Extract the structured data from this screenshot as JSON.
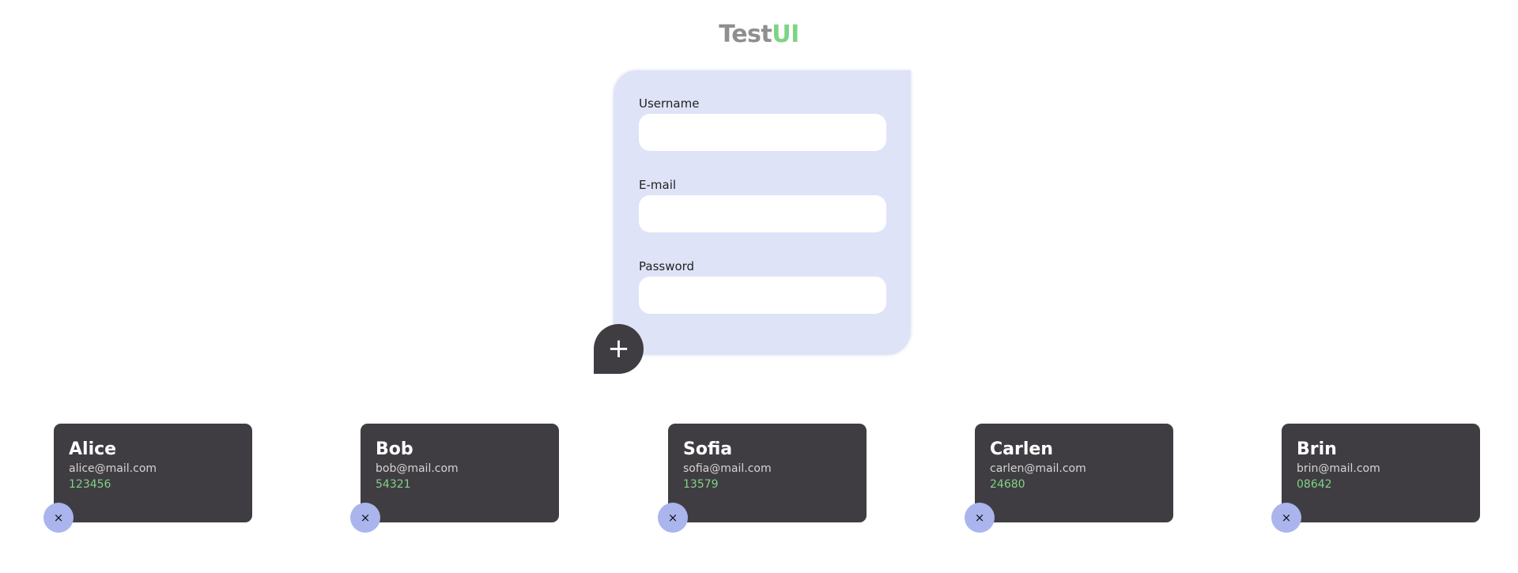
{
  "logo": {
    "part1": "Test",
    "part2": "UI"
  },
  "form": {
    "username_label": "Username",
    "username_value": "",
    "email_label": "E-mail",
    "email_value": "",
    "password_label": "Password",
    "password_value": "",
    "add_icon": "+"
  },
  "users": [
    {
      "name": "Alice",
      "email": "alice@mail.com",
      "code": "123456"
    },
    {
      "name": "Bob",
      "email": "bob@mail.com",
      "code": "54321"
    },
    {
      "name": "Sofia",
      "email": "sofia@mail.com",
      "code": "13579"
    },
    {
      "name": "Carlen",
      "email": "carlen@mail.com",
      "code": "24680"
    },
    {
      "name": "Brin",
      "email": "brin@mail.com",
      "code": "08642"
    }
  ],
  "delete_icon": "×",
  "colors": {
    "accent_green": "#7fd384",
    "form_bg": "#dfe3f7",
    "card_bg": "#403d42",
    "delete_bg": "#aab5ee"
  }
}
